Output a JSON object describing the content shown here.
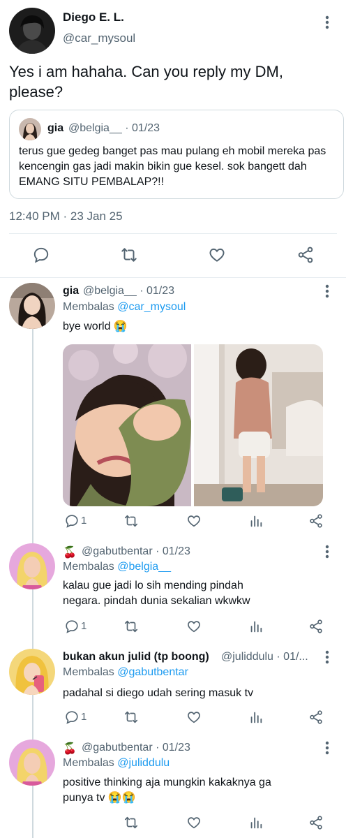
{
  "main_tweet": {
    "author_name": "Diego E. L.",
    "author_handle": "@car_mysoul",
    "text": "Yes i am hahaha. Can you reply my DM, please?",
    "quote": {
      "author_name": "gia",
      "meta": "@belgia__ · 01/23",
      "text": "terus gue gedeg banget pas mau pulang eh mobil mereka pas kencengin gas jadi makin bikin gue kesel. sok bangett dah EMANG SITU PEMBALAP?!!"
    },
    "timestamp": "12:40 PM · 23 Jan 25",
    "icons": [
      "reply-icon",
      "retweet-icon",
      "like-icon",
      "share-icon"
    ]
  },
  "replies": [
    {
      "author_name": "gia",
      "meta": "@belgia__ · 01/23",
      "replying_prefix": "Membalas ",
      "replying_to": "@car_mysoul",
      "text": "bye world 😭",
      "reply_count": "1",
      "avatar_color": "#8a6b5a"
    },
    {
      "author_name": "🍒",
      "meta": "@gabutbentar · 01/23",
      "replying_prefix": "Membalas ",
      "replying_to": "@belgia__",
      "text": "kalau gue jadi lo sih mending pindah negara. pindah dunia sekalian wkwkw",
      "reply_count": "1",
      "avatar_color": "#e3a6d9"
    },
    {
      "author_name": "bukan akun julid (tp boong)",
      "meta": "@juliddulu · 01/...",
      "replying_prefix": "Membalas ",
      "replying_to": "@gabutbentar",
      "text": "padahal si diego udah sering masuk tv",
      "reply_count": "1",
      "avatar_color": "#f2c94c"
    },
    {
      "author_name": "🍒",
      "meta": "@gabutbentar · 01/23",
      "replying_prefix": "Membalas ",
      "replying_to": "@juliddulu",
      "text": "positive thinking aja mungkin kakaknya ga punya tv 😭😭",
      "reply_count": "",
      "avatar_color": "#e3a6d9"
    }
  ],
  "colors": {
    "text": "#0f1419",
    "secondary": "#536471",
    "link": "#1d9bf0",
    "border": "#cfd9de"
  }
}
